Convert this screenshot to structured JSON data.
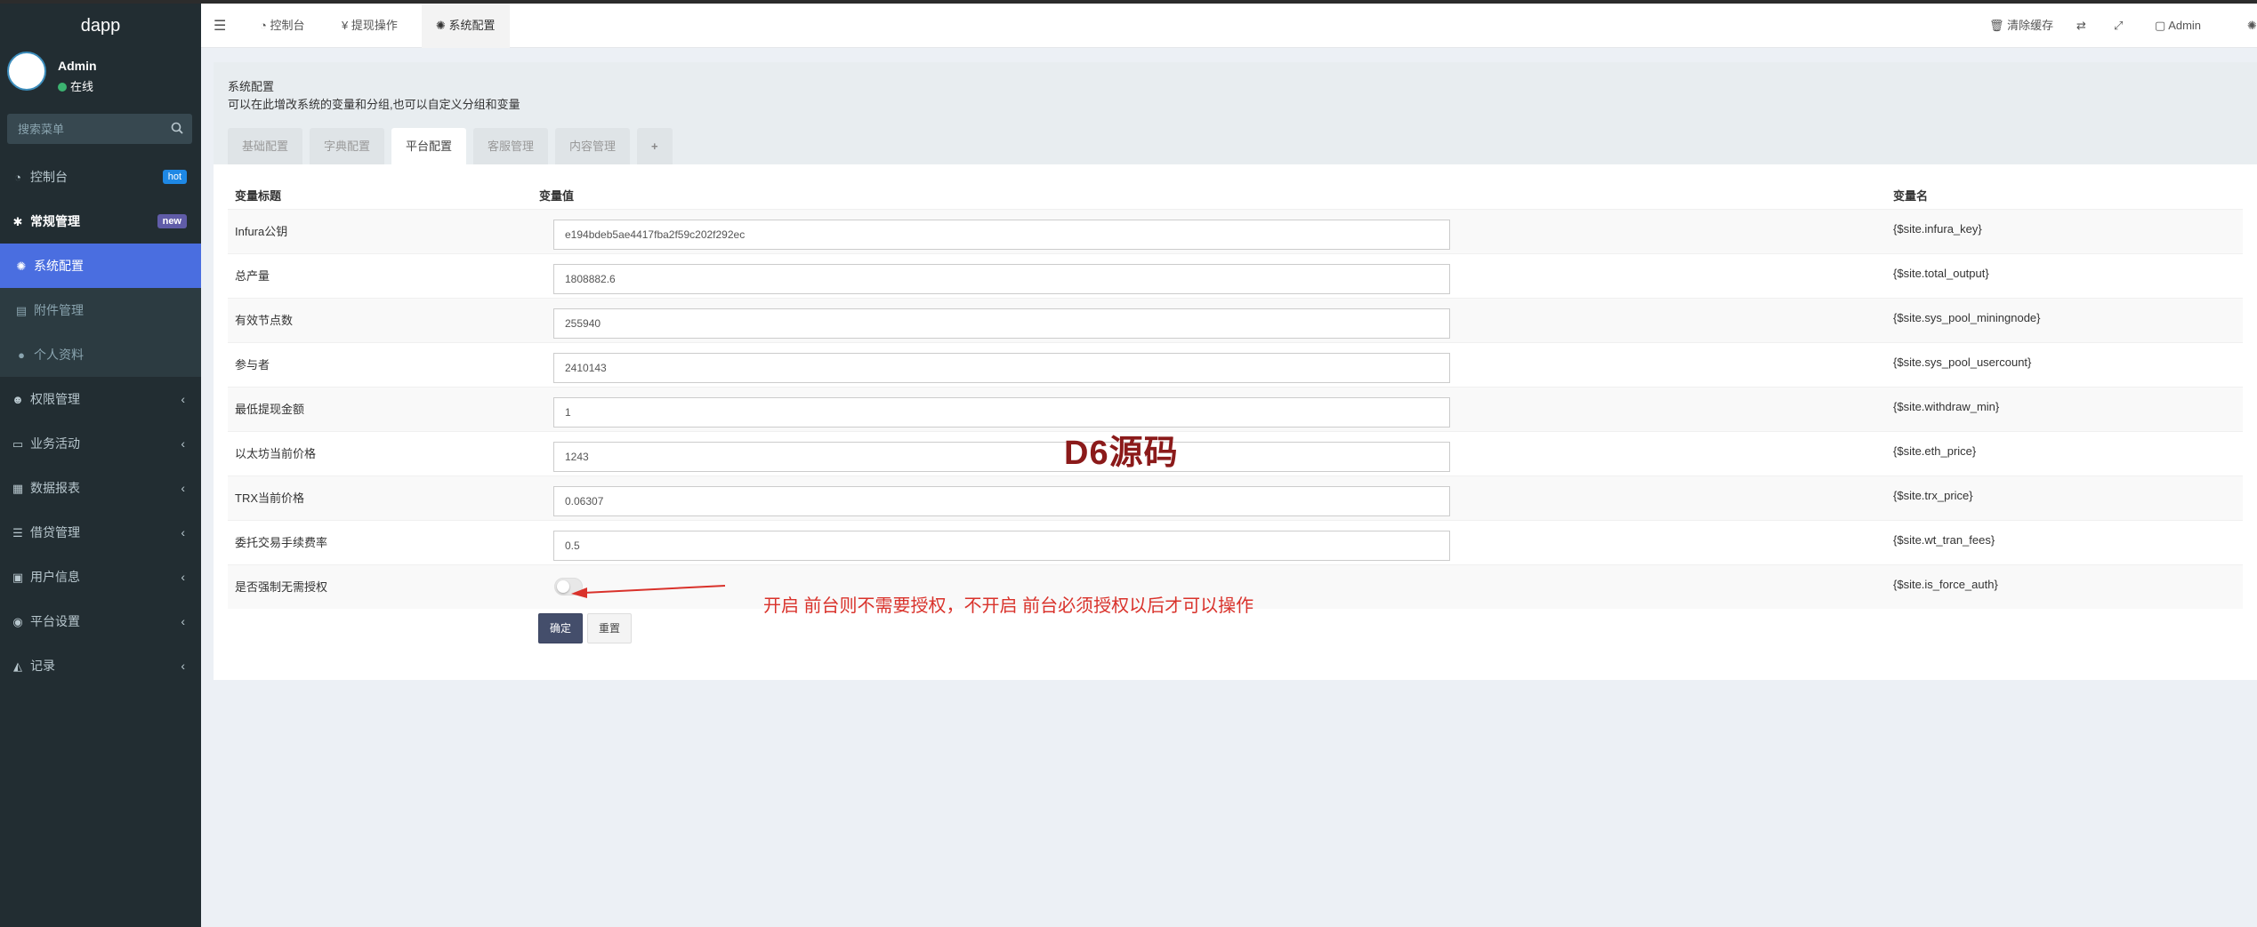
{
  "app": {
    "brand": "dapp"
  },
  "user": {
    "name": "Admin",
    "status": "在线"
  },
  "search": {
    "placeholder": "搜索菜单"
  },
  "sidebar": {
    "items": [
      {
        "icon": "dashboard-icon",
        "label": "控制台",
        "badge": "hot",
        "badge_color": "#1e88e5"
      },
      {
        "icon": "cogs-icon",
        "label": "常规管理",
        "badge": "new",
        "badge_color": "#605ca8"
      },
      {
        "icon": "gear-icon",
        "label": "系统配置",
        "active": true
      },
      {
        "icon": "file-icon",
        "label": "附件管理"
      },
      {
        "icon": "user-icon",
        "label": "个人资料"
      },
      {
        "icon": "group-icon",
        "label": "权限管理"
      },
      {
        "icon": "id-card-icon",
        "label": "业务活动"
      },
      {
        "icon": "report-icon",
        "label": "数据报表"
      },
      {
        "icon": "list-icon",
        "label": "借贷管理"
      },
      {
        "icon": "address-card-icon",
        "label": "用户信息"
      },
      {
        "icon": "dot-circle-icon",
        "label": "平台设置"
      },
      {
        "icon": "area-chart-icon",
        "label": "记录"
      }
    ]
  },
  "header": {
    "tabs": [
      {
        "icon": "dashboard-icon",
        "label": "控制台"
      },
      {
        "icon": "yen-icon",
        "label": "提现操作"
      },
      {
        "icon": "gear-icon",
        "label": "系统配置",
        "active": true
      }
    ],
    "clear_cache": "清除缓存",
    "admin": "Admin"
  },
  "panel": {
    "title": "系统配置",
    "description": "可以在此增改系统的变量和分组,也可以自定义分组和变量",
    "tabs": [
      "基础配置",
      "字典配置",
      "平台配置",
      "客服管理",
      "内容管理",
      "+"
    ],
    "active_tab": "平台配置"
  },
  "table": {
    "headers": {
      "title": "变量标题",
      "value": "变量值",
      "name": "变量名"
    },
    "rows": [
      {
        "title": "Infura公钥",
        "value": "e194bdeb5ae4417fba2f59c202f292ec",
        "name": "{$site.infura_key}"
      },
      {
        "title": "总产量",
        "value": "1808882.6",
        "name": "{$site.total_output}"
      },
      {
        "title": "有效节点数",
        "value": "255940",
        "name": "{$site.sys_pool_miningnode}"
      },
      {
        "title": "参与者",
        "value": "2410143",
        "name": "{$site.sys_pool_usercount}"
      },
      {
        "title": "最低提现金额",
        "value": "1",
        "name": "{$site.withdraw_min}"
      },
      {
        "title": "以太坊当前价格",
        "value": "1243",
        "name": "{$site.eth_price}"
      },
      {
        "title": "TRX当前价格",
        "value": "0.06307",
        "name": "{$site.trx_price}"
      },
      {
        "title": "委托交易手续费率",
        "value": "0.5",
        "name": "{$site.wt_tran_fees}"
      },
      {
        "title": "是否强制无需授权",
        "toggle": false,
        "name": "{$site.is_force_auth}"
      }
    ]
  },
  "buttons": {
    "confirm": "确定",
    "reset": "重置"
  },
  "watermark": "D6源码",
  "annotation": "开启 前台则不需要授权，不开启 前台必须授权以后才可以操作"
}
